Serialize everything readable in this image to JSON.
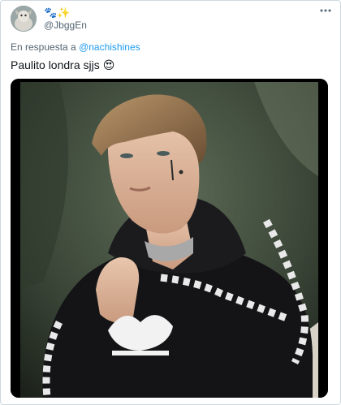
{
  "tweet": {
    "display_name": "🐾✨",
    "handle": "@JbggEn",
    "more_icon": "more-horizontal-icon",
    "reply_prefix": "En respuesta a",
    "reply_mention": "@nachishines",
    "text": "Paulito londra sjjs",
    "emoji": "😍"
  },
  "colors": {
    "link": "#1d9bf0",
    "secondary_text": "#536471",
    "border": "#cfd9de"
  }
}
